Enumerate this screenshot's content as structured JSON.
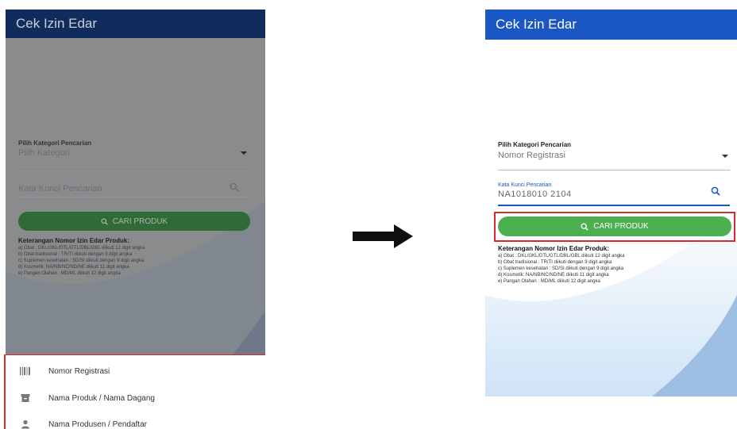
{
  "left_phone": {
    "app_title": "Cek Izin Edar",
    "category_label": "Pilih Kategori Pencarian",
    "category_value": "Pilih Kategori",
    "keyword_placeholder": "Kata Kunci Pencarian",
    "search_button": "CARI PRODUK",
    "legend_title": "Keterangan Nomor Izin Edar Produk:",
    "legend_items": [
      "a) Obat : DKL/GKL/DTL/GTL/DBL/GBL diikuti 12 digit angka",
      "b) Obat tradisional : TR/TI diikuti dengan 9 digit angka",
      "c) Suplemen kesehatan : SD/SI diikuti dengan 9 digit angka",
      "d) Kosmetik: NA/NB/NC/ND/NE diikuti 11 digit angka",
      "e) Pangan Olahan : MD/ML diikuti 12 digit angka"
    ],
    "sheet_options": [
      {
        "label": "Nomor Registrasi",
        "icon": "barcode-icon"
      },
      {
        "label": "Nama Produk / Nama Dagang",
        "icon": "archive-icon"
      },
      {
        "label": "Nama Produsen / Pendaftar",
        "icon": "person-icon"
      }
    ]
  },
  "right_phone": {
    "app_title": "Cek Izin Edar",
    "category_label": "Pilih Kategori Pencarian",
    "category_value": "Nomor Registrasi",
    "keyword_label": "Kata Kunci Pencarian",
    "keyword_value": "NA1018010 2104",
    "search_button": "CARI PRODUK",
    "legend_title": "Keterangan Nomor Izin Edar Produk:",
    "legend_items": [
      "a) Obat : DKL/GKL/DTL/GTL/DBL/GBL diikuti 12 digit angka",
      "b) Obat tradisional : TR/TI diikuti dengan 9 digit angka",
      "c) Suplemen kesehatan : SD/SI diikuti dengan 9 digit angka",
      "d) Kosmetik: NA/NB/NC/ND/NE diikuti 11 digit angka",
      "e) Pangan Olahan : MD/ML diikuti 12 digit angka"
    ]
  },
  "colors": {
    "appbar_dim": "#0f2c5c",
    "appbar": "#1a56c4",
    "button_green": "#4caf50",
    "button_green_dim": "#2e6b37",
    "highlight_red": "#d72a2a",
    "arrow": "#111111"
  }
}
